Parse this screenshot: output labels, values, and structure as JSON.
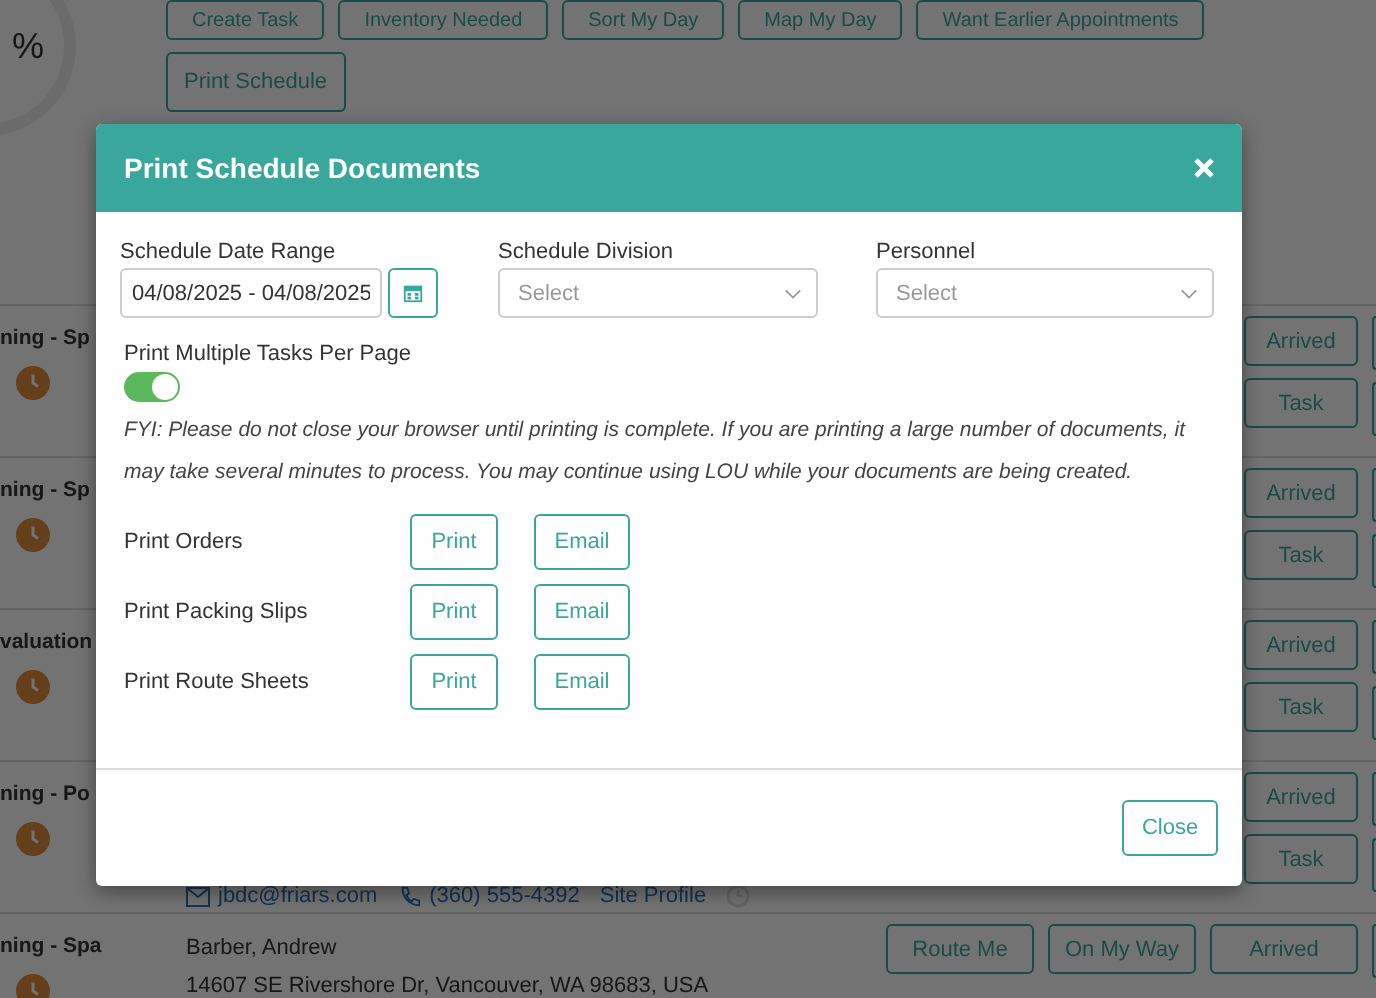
{
  "progress": {
    "label": "%"
  },
  "toolbar": {
    "buttons": [
      "Create Task",
      "Inventory Needed",
      "Sort My Day",
      "Map My Day",
      "Want Earlier Appointments"
    ],
    "print_button": "Print Schedule"
  },
  "tasks": [
    {
      "title": "ning - Sp",
      "buttons": [
        "Arrived",
        "Task"
      ]
    },
    {
      "title": "ning - Sp",
      "buttons": [
        "Arrived",
        "Task"
      ]
    },
    {
      "title": "valuation",
      "buttons": [
        "Arrived",
        "Task"
      ]
    },
    {
      "title": "ning - Po",
      "buttons": [
        "Arrived",
        "Task"
      ],
      "contact": {
        "email": "jbdc@friars.com",
        "phone": "(360) 555-4392",
        "link": "Site Profile"
      }
    },
    {
      "title": "ning - Spa",
      "customer": "Barber, Andrew",
      "address": "14607 SE Rivershore Dr, Vancouver, WA 98683, USA",
      "buttons": [
        "Route Me",
        "On My Way",
        "Arrived"
      ]
    }
  ],
  "modal": {
    "title": "Print Schedule Documents",
    "date_range": {
      "label": "Schedule Date Range",
      "value": "04/08/2025 - 04/08/2025"
    },
    "division": {
      "label": "Schedule Division",
      "placeholder": "Select"
    },
    "personnel": {
      "label": "Personnel",
      "placeholder": "Select"
    },
    "multiple_per_page": {
      "label": "Print Multiple Tasks Per Page",
      "on": true
    },
    "notice": "FYI: Please do not close your browser until printing is complete. If you are printing a large number of documents, it may take several minutes to process. You may continue using LOU while your documents are being created.",
    "documents": [
      {
        "label": "Print Orders",
        "actions": [
          "Print",
          "Email"
        ]
      },
      {
        "label": "Print Packing Slips",
        "actions": [
          "Print",
          "Email"
        ]
      },
      {
        "label": "Print Route Sheets",
        "actions": [
          "Print",
          "Email"
        ]
      }
    ],
    "close_button": "Close"
  }
}
